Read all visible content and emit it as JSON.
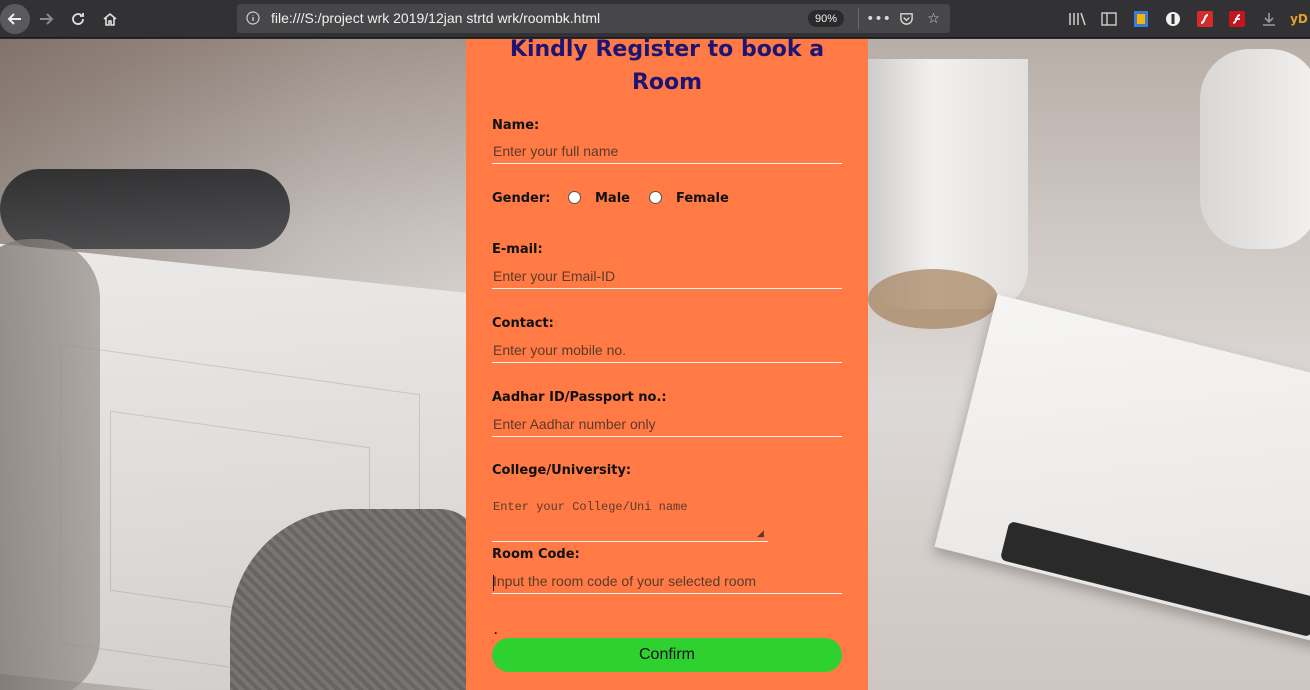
{
  "browser": {
    "url": "file:///S:/project wrk 2019/12jan strtd wrk/roombk.html",
    "zoom": "90%",
    "right_trailing_text": "yD"
  },
  "form": {
    "title": "Kindly Register to book a Room",
    "name": {
      "label": "Name:",
      "placeholder": "Enter your full name"
    },
    "gender": {
      "label": "Gender:",
      "options": [
        "Male",
        "Female"
      ]
    },
    "email": {
      "label": "E-mail:",
      "placeholder": "Enter your Email-ID"
    },
    "contact": {
      "label": "Contact:",
      "placeholder": "Enter your mobile no."
    },
    "aadhar": {
      "label": "Aadhar ID/Passport no.:",
      "placeholder": "Enter Aadhar number only"
    },
    "college": {
      "label": "College/University:",
      "placeholder": "Enter your College/Uni name"
    },
    "room_code": {
      "label": "Room Code:",
      "placeholder": "Input the room code of your selected room"
    },
    "dot": ".",
    "confirm_label": "Confirm"
  },
  "colors": {
    "panel_bg": "#ff7a45",
    "title_color": "#1d1574",
    "confirm_bg": "#2fd130"
  }
}
